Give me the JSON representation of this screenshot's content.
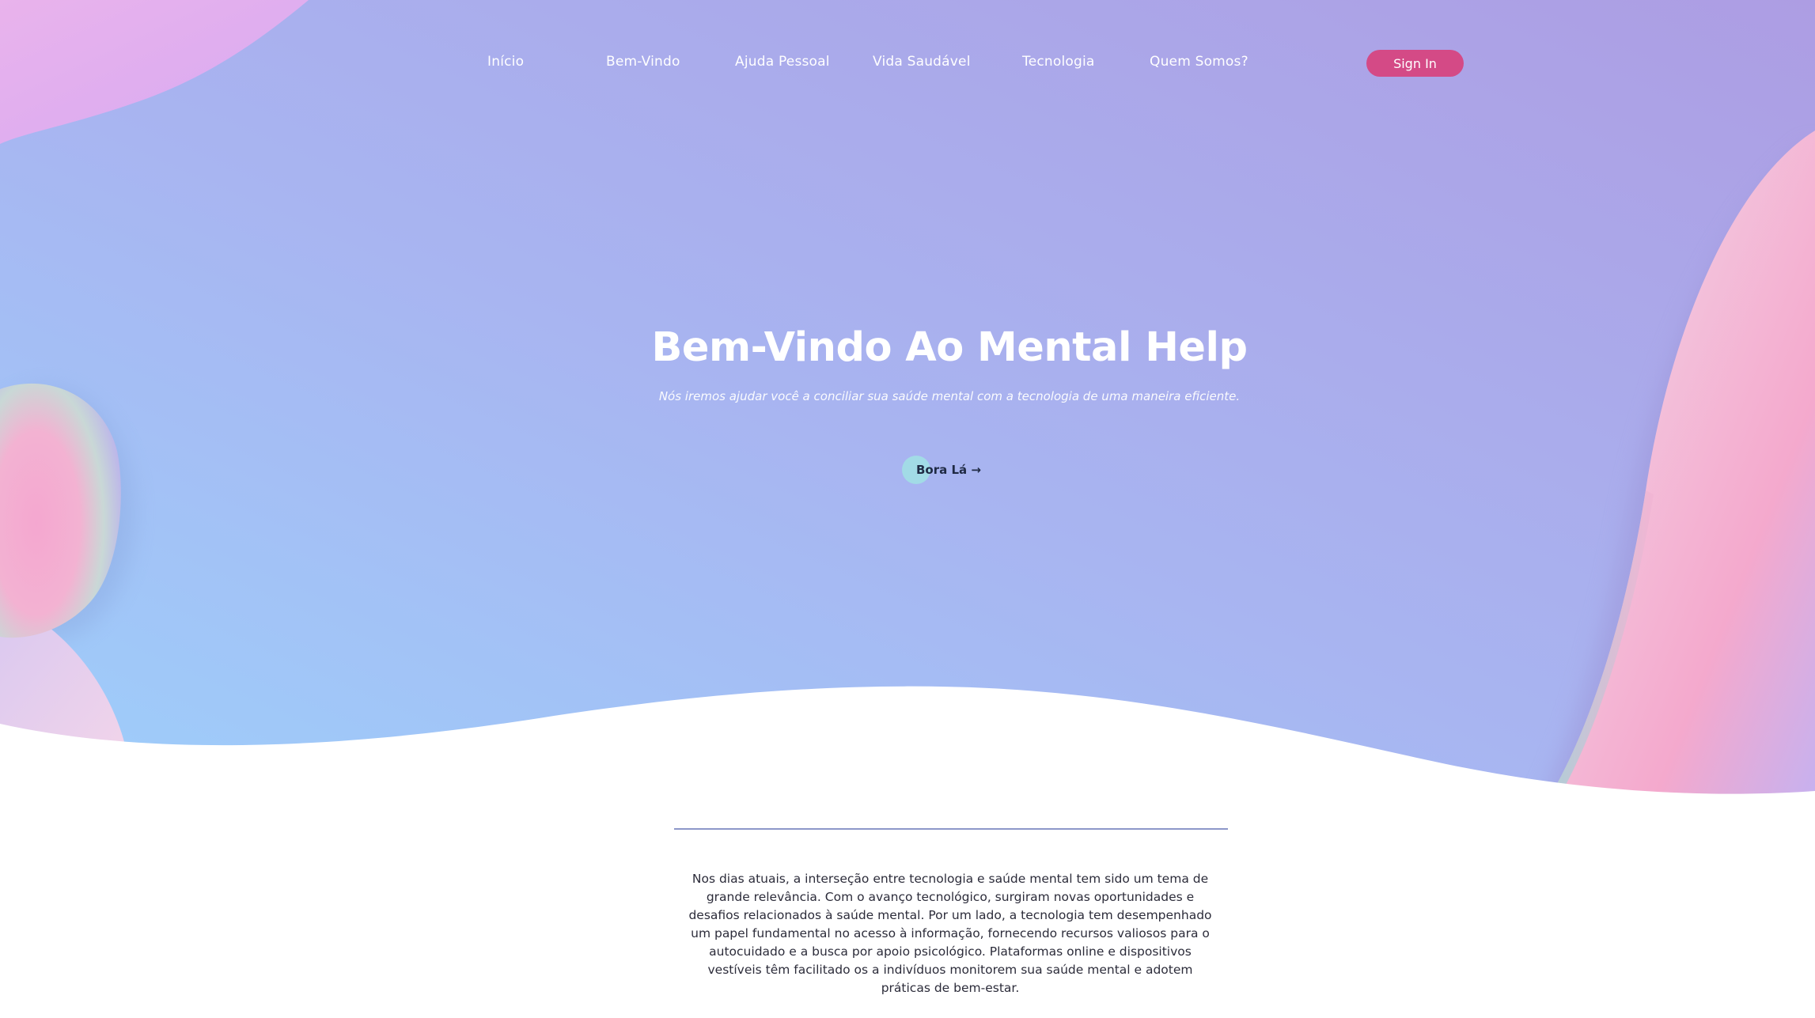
{
  "nav": {
    "items": [
      {
        "label": "Início"
      },
      {
        "label": "Bem-Vindo"
      },
      {
        "label": "Ajuda Pessoal"
      },
      {
        "label": "Vida Saudável"
      },
      {
        "label": "Tecnologia"
      },
      {
        "label": "Quem Somos?"
      }
    ],
    "signin_label": "Sign In"
  },
  "hero": {
    "title": "Bem-Vindo Ao Mental Help",
    "subtitle": "Nós iremos ajudar você a conciliar sua saúde mental com a tecnologia de uma maneira eficiente.",
    "cta_label": "Bora Lá →"
  },
  "content": {
    "paragraph": "Nos dias atuais, a interseção entre tecnologia e saúde mental tem sido um tema de grande relevância. Com o avanço tecnológico, surgiram novas oportunidades e desafios relacionados à saúde mental. Por um lado, a tecnologia tem desempenhado um papel fundamental no acesso à informação, fornecendo recursos valiosos para o autocuidado e a busca por apoio psicológico. Plataformas online e dispositivos vestíveis têm facilitado os a indivíduos monitorem sua saúde mental e adotem práticas de bem-estar."
  },
  "colors": {
    "signin_bg": "#d44a86",
    "cta_circle": "#a2dbe6",
    "hero_gradient_start": "#9fcdfa",
    "hero_gradient_end": "#ad9ee4",
    "divider": "#8d97c9"
  }
}
